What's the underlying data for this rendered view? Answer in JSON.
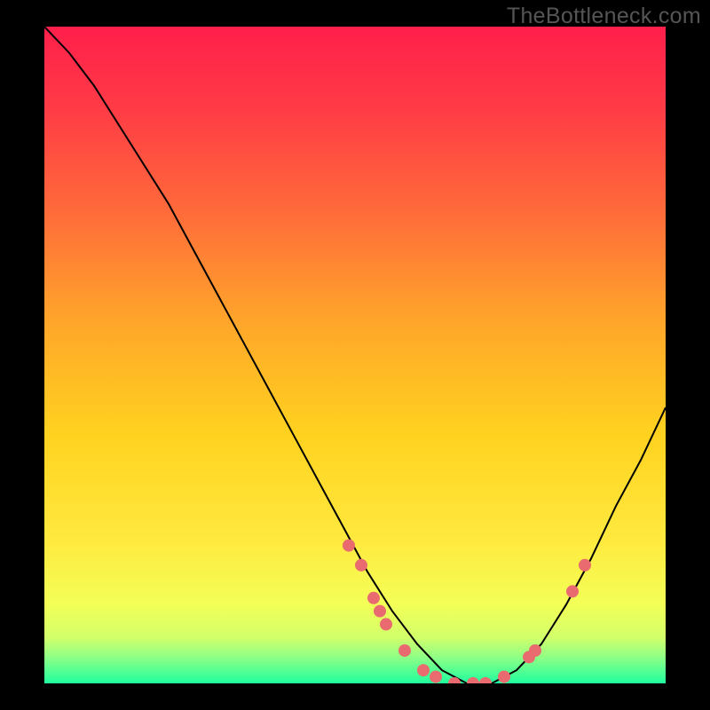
{
  "watermark": "TheBottleneck.com",
  "chart_data": {
    "type": "line",
    "title": "",
    "xlabel": "",
    "ylabel": "",
    "xlim": [
      0,
      100
    ],
    "ylim": [
      0,
      100
    ],
    "background_gradient": {
      "stops": [
        {
          "pct": 0,
          "color": "#ff1f4b"
        },
        {
          "pct": 12,
          "color": "#ff3a46"
        },
        {
          "pct": 28,
          "color": "#ff6a3a"
        },
        {
          "pct": 45,
          "color": "#ffa62a"
        },
        {
          "pct": 62,
          "color": "#ffd21f"
        },
        {
          "pct": 78,
          "color": "#ffe93e"
        },
        {
          "pct": 88,
          "color": "#f3ff57"
        },
        {
          "pct": 93,
          "color": "#d2ff6a"
        },
        {
          "pct": 96,
          "color": "#8fff86"
        },
        {
          "pct": 100,
          "color": "#1fff9e"
        }
      ]
    },
    "series": [
      {
        "name": "bottleneck-curve",
        "color": "#000000",
        "width": 2,
        "x": [
          0,
          4,
          8,
          12,
          16,
          20,
          24,
          28,
          32,
          36,
          40,
          44,
          48,
          52,
          56,
          60,
          64,
          68,
          72,
          76,
          80,
          84,
          88,
          92,
          96,
          100
        ],
        "y": [
          100,
          96,
          91,
          85,
          79,
          73,
          66,
          59,
          52,
          45,
          38,
          31,
          24,
          17,
          11,
          6,
          2,
          0,
          0,
          2,
          6,
          12,
          19,
          27,
          34,
          42
        ]
      }
    ],
    "markers": {
      "name": "highlighted-points",
      "color": "#e96a6f",
      "radius": 7,
      "points": [
        {
          "x": 49,
          "y": 21
        },
        {
          "x": 51,
          "y": 18
        },
        {
          "x": 53,
          "y": 13
        },
        {
          "x": 54,
          "y": 11
        },
        {
          "x": 55,
          "y": 9
        },
        {
          "x": 58,
          "y": 5
        },
        {
          "x": 61,
          "y": 2
        },
        {
          "x": 63,
          "y": 1
        },
        {
          "x": 66,
          "y": 0
        },
        {
          "x": 69,
          "y": 0
        },
        {
          "x": 71,
          "y": 0
        },
        {
          "x": 74,
          "y": 1
        },
        {
          "x": 78,
          "y": 4
        },
        {
          "x": 79,
          "y": 5
        },
        {
          "x": 85,
          "y": 14
        },
        {
          "x": 87,
          "y": 18
        }
      ]
    }
  }
}
